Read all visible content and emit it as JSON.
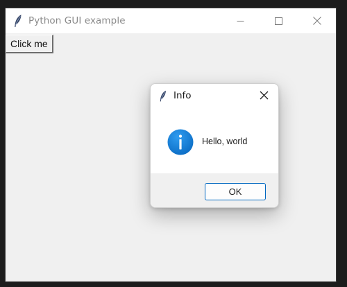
{
  "window": {
    "title": "Python GUI example",
    "icon": "feather-icon",
    "controls": [
      "minimize-icon",
      "maximize-icon",
      "close-icon"
    ]
  },
  "main": {
    "button_label": "Click me"
  },
  "dialog": {
    "title": "Info",
    "icon": "feather-icon",
    "message_icon": "info-icon",
    "message": "Hello, world",
    "ok_label": "OK",
    "accent_color": "#0067c0",
    "info_icon_color": "#1a86d9"
  }
}
